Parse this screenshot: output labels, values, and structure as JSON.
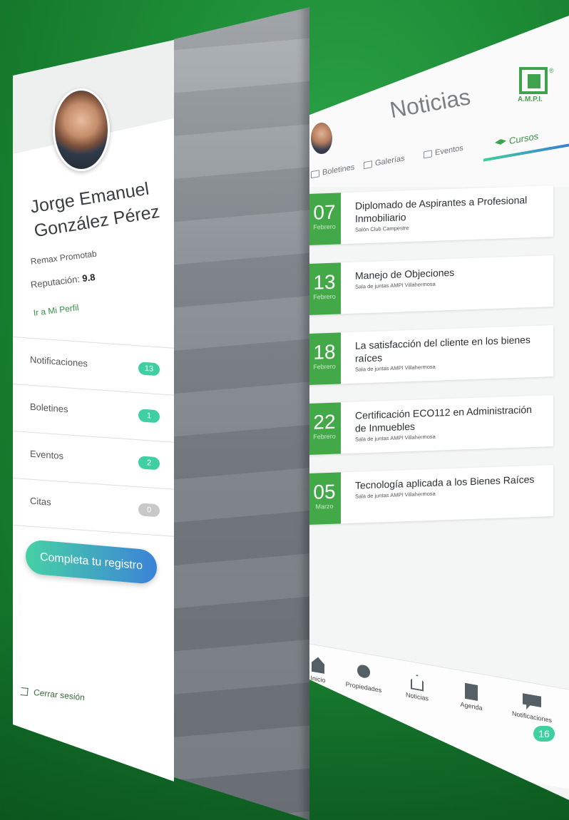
{
  "profile_menu": {
    "user_name": "Jorge Emanuel González Pérez",
    "company": "Remax  Promotab",
    "reputation_label": "Reputación:",
    "reputation_value": "9.8",
    "profile_link": "Ir a Mi Perfil",
    "items": [
      {
        "label": "Notificaciones",
        "count": "13"
      },
      {
        "label": "Boletines",
        "count": "1"
      },
      {
        "label": "Eventos",
        "count": "2"
      },
      {
        "label": "Citas",
        "count": "0"
      }
    ],
    "cta_label": "Completa tu registro",
    "logout_label": "Cerrar sesión"
  },
  "news": {
    "title": "Noticias",
    "logo_text": "A.M.P.I.",
    "logo_reg": "®",
    "tabs": [
      {
        "label": "Boletines",
        "icon": "newspaper-icon"
      },
      {
        "label": "Galerías",
        "icon": "image-icon"
      },
      {
        "label": "Eventos",
        "icon": "calendar-icon"
      },
      {
        "label": "Cursos",
        "icon": "graduation-cap-icon",
        "active": true
      }
    ],
    "courses": [
      {
        "day": "07",
        "month": "Febrero",
        "title": "Diplomado de Aspirantes a Profesional Inmobiliario",
        "location": "Salón Club Campestre"
      },
      {
        "day": "13",
        "month": "Febrero",
        "title": "Manejo de Objeciones",
        "location": "Sala de juntas AMPI Villahermosa"
      },
      {
        "day": "18",
        "month": "Febrero",
        "title": "La satisfacción del cliente en los bienes raíces",
        "location": "Sala de juntas AMPI Villahermosa"
      },
      {
        "day": "22",
        "month": "Febrero",
        "title": "Certificación ECO112 en Administración de Inmuebles",
        "location": "Sala de juntas AMPI Villahermosa"
      },
      {
        "day": "05",
        "month": "Marzo",
        "title": "Tecnología aplicada a los Bienes Raíces",
        "location": "Sala de juntas AMPI Villahermosa"
      }
    ],
    "bottom_nav": [
      {
        "label": "Inicio",
        "icon": "home-icon"
      },
      {
        "label": "Propiedades",
        "icon": "location-pin-icon"
      },
      {
        "label": "Noticias",
        "icon": "newspaper-icon"
      },
      {
        "label": "Agenda",
        "icon": "agenda-icon"
      },
      {
        "label": "Notificaciones",
        "icon": "chat-icon"
      }
    ],
    "notifications_badge": "16"
  },
  "colors": {
    "background_green": "#1c8a35",
    "accent_green": "#43a847",
    "badge_teal": "#3fcfa0",
    "cta_gradient_start": "#47d1a5",
    "cta_gradient_end": "#3b83d8"
  }
}
